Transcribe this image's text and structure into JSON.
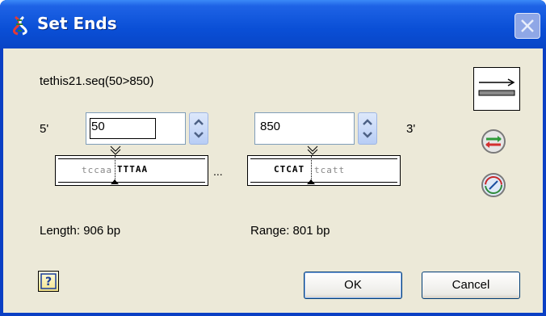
{
  "window": {
    "title": "Set Ends"
  },
  "sequence": {
    "name": "tethis21.seq(50>850)"
  },
  "ends": {
    "five_prime_label": "5'",
    "three_prime_label": "3'",
    "start_value": "50",
    "end_value": "850",
    "ellipsis": "..."
  },
  "start_context": {
    "lower": "tccaa",
    "upper": "TTTAA"
  },
  "end_context": {
    "upper": "CTCAT",
    "lower": "tcatt"
  },
  "info": {
    "length": "Length: 906 bp",
    "range": "Range: 801 bp"
  },
  "buttons": {
    "ok": "OK",
    "cancel": "Cancel",
    "help": "?"
  },
  "icons": [
    "app-dna-icon",
    "close-icon",
    "spin-up-icon",
    "spin-down-icon",
    "marker-icon",
    "sequence-direction-icon",
    "swap-strand-icon",
    "circular-icon",
    "help-icon"
  ],
  "colors": {
    "title_bar": "#0a4fd6",
    "dialog_bg": "#ece9d8",
    "button_border": "#003c74"
  }
}
